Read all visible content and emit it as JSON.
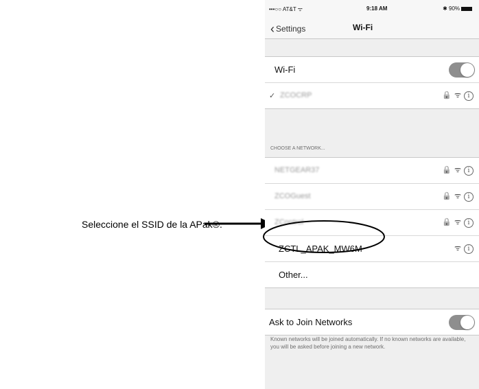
{
  "status_bar": {
    "carrier": "•••○○ AT&T",
    "wifi": "ᯤ",
    "time": "9:18 AM",
    "battery": "✱ 90%"
  },
  "nav": {
    "back_label": "Settings",
    "title": "Wi-Fi"
  },
  "wifi_row": {
    "label": "Wi-Fi",
    "enabled": true
  },
  "connected": {
    "check": "✓",
    "name": "ZCOCRP"
  },
  "section_header": "CHOOSE A NETWORK...",
  "networks": [
    {
      "name": "NETGEAR37",
      "secured": true
    },
    {
      "name": "ZCOGuest",
      "secured": true
    },
    {
      "name": "ZControl",
      "secured": true
    },
    {
      "name": "ZCTL_APAK_MW6M",
      "secured": false
    }
  ],
  "other_label": "Other...",
  "ask_to_join": {
    "label": "Ask to Join Networks",
    "enabled": true
  },
  "footer_text": "Known networks will be joined automatically. If no known networks are available, you will be asked before joining a new network.",
  "icons": {
    "lock": "🔒",
    "wifi": "ᯤ",
    "info": "i"
  },
  "annotation": "Seleccione el SSID de la APak®."
}
